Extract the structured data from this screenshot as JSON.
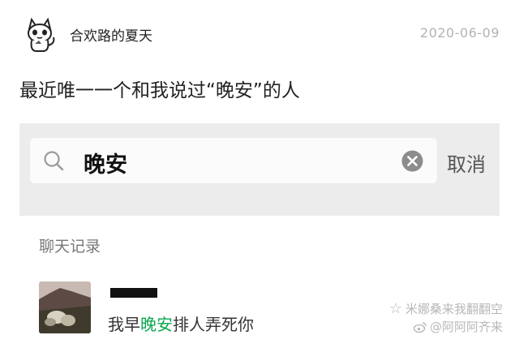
{
  "post": {
    "author": "合欢路的夏天",
    "date": "2020-06-09",
    "text": "最近唯一一个和我说过“晚安”的人"
  },
  "search": {
    "query": "晚安",
    "cancel_label": "取消"
  },
  "results": {
    "section_title": "聊天记录",
    "message_before": "我早",
    "message_highlight": "晚安",
    "message_after": "排人弄死你",
    "highlight_color": "#0aa74b"
  },
  "watermark": {
    "line1": "米娜桑来我翻翻空",
    "line2": "@阿阿阿齐来"
  },
  "icons": {
    "avatar": "cat-avatar-icon",
    "search": "search-icon",
    "clear": "clear-icon",
    "star": "star-icon",
    "weibo": "weibo-icon"
  }
}
